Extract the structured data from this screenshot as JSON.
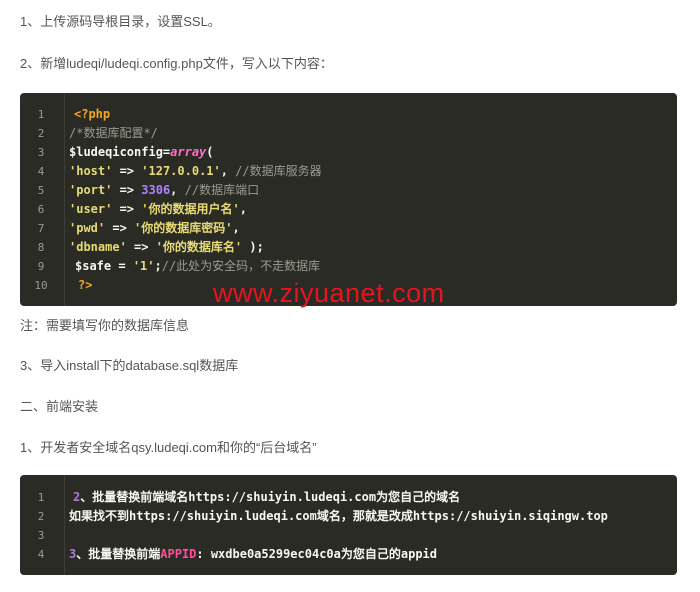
{
  "paragraphs": {
    "p1": "1、上传源码导根目录，设置SSL。",
    "p2": "2、新增ludeqi/ludeqi.config.php文件，写入以下内容：",
    "p3": "注：需要填写你的数据库信息",
    "p4": "3、导入install下的database.sql数据库",
    "p5": "二、前端安装",
    "p6": "1、开发者安全域名qsy.ludeqi.com和你的“后台域名”"
  },
  "code_block_1": {
    "line_numbers": [
      "1",
      "2",
      "3",
      "4",
      "5",
      "6",
      "7",
      "8",
      "9",
      "10"
    ],
    "l1": "<?php",
    "l2": "/*数据库配置*/",
    "l3_var": "$ludeqiconfig",
    "l3_eq": "=",
    "l3_fn": "array",
    "l3_paren": "(",
    "l4_key": "'host'",
    "l4_arrow": " => ",
    "l4_val": "'127.0.0.1'",
    "l4_comma": ", ",
    "l4_cm": "//数据库服务器",
    "l5_key": "'port'",
    "l5_arrow": " => ",
    "l5_val": "3306",
    "l5_comma": ", ",
    "l5_cm": "//数据库端口",
    "l6_key": "'user'",
    "l6_arrow": " => ",
    "l6_val": "'你的数据用户名'",
    "l6_comma": ",",
    "l7_key": "'pwd'",
    "l7_arrow": " => ",
    "l7_val": "'你的数据库密码'",
    "l7_comma": ",",
    "l8_key": "'dbname'",
    "l8_arrow": " => ",
    "l8_val": "'你的数据库名'",
    "l8_end": " );",
    "l9_var": "$safe",
    "l9_eq": " = ",
    "l9_val": "'1'",
    "l9_semi": ";",
    "l9_cm": "//此处为安全码，不走数据库",
    "l10": "?>"
  },
  "watermark": "www.ziyuanet.com",
  "code_block_2": {
    "line_numbers": [
      "1",
      "2",
      "3",
      "4"
    ],
    "l1_num": "2",
    "l1_text": "、批量替换前端域名https://shuiyin.ludeqi.com为您自己的域名",
    "l2_text": "如果找不到https://shuiyin.ludeqi.com域名，那就是改成https://shuiyin.siqingw.top",
    "l4_num": "3",
    "l4_a": "、批量替换前端",
    "l4_appid": "APPID",
    "l4_b": ": wxdbe0a5299ec04c0a为您自己的appid"
  }
}
